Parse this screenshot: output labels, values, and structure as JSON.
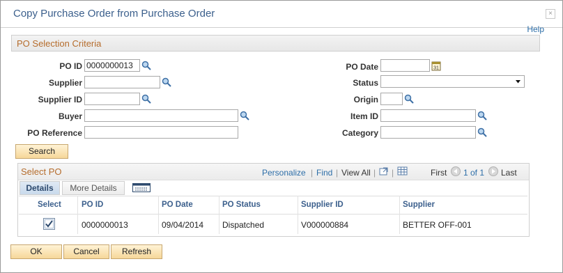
{
  "window": {
    "title": "Copy Purchase Order from Purchase Order",
    "close_label": "×",
    "help_label": "Help"
  },
  "section": {
    "title": "PO Selection Criteria"
  },
  "form": {
    "po_id_label": "PO ID",
    "po_id_value": "0000000013",
    "supplier_label": "Supplier",
    "supplier_value": "",
    "supplier_id_label": "Supplier ID",
    "supplier_id_value": "",
    "buyer_label": "Buyer",
    "buyer_value": "",
    "po_reference_label": "PO Reference",
    "po_reference_value": "",
    "po_date_label": "PO Date",
    "po_date_value": "",
    "status_label": "Status",
    "status_value": "",
    "origin_label": "Origin",
    "origin_value": "",
    "item_id_label": "Item ID",
    "item_id_value": "",
    "category_label": "Category",
    "category_value": "",
    "search_button": "Search"
  },
  "grid": {
    "title": "Select PO",
    "personalize": "Personalize",
    "find": "Find",
    "view_all": "View All",
    "first": "First",
    "range": "1 of 1",
    "last": "Last",
    "tabs": [
      "Details",
      "More Details"
    ],
    "columns": [
      "Select",
      "PO ID",
      "PO Date",
      "PO Status",
      "Supplier ID",
      "Supplier"
    ],
    "rows": [
      {
        "selected": true,
        "po_id": "0000000013",
        "po_date": "09/04/2014",
        "po_status": "Dispatched",
        "supplier_id": "V000000884",
        "supplier": "BETTER OFF-001"
      }
    ]
  },
  "footer": {
    "ok": "OK",
    "cancel": "Cancel",
    "refresh": "Refresh"
  },
  "colors": {
    "title": "#3b5f8c",
    "section_title": "#b56c2c",
    "link": "#2d6ea8",
    "button_fill": "#f6d799"
  }
}
